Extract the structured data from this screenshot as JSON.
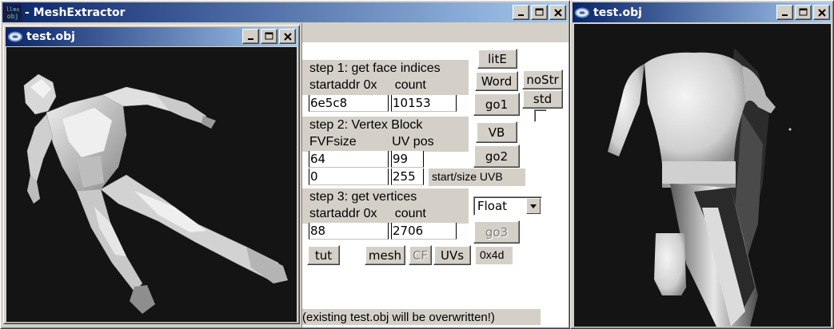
{
  "main_window": {
    "title": "- MeshExtractor",
    "icon_text_top": "ll⊗x",
    "icon_text_bottom": "obj"
  },
  "left_viewer": {
    "title": "test.obj"
  },
  "right_viewer": {
    "title": "test.obj"
  },
  "panel": {
    "step1_label": "step 1: get face indices",
    "step1_sub": "startaddr 0x     count",
    "face_startaddr": "6e5c8",
    "face_count": "10153",
    "step2_label": "step 2: Vertex Block",
    "step2_sub": "FVFsize          UV pos",
    "fvf_size": "64",
    "uv_pos": "99",
    "uvb_start": "0",
    "uvb_size": "255",
    "uvb_label": "start/size UVB",
    "step3_label": "step 3: get vertices",
    "step3_sub": "startaddr 0x     count",
    "vert_startaddr": "88",
    "vert_count": "2706",
    "format_selected": "Float",
    "hex_readout": "0x4d",
    "warning": "(existing test.obj will be overwritten!)"
  },
  "buttons": {
    "lite": "litE",
    "word": "Word",
    "nostr": "noStr",
    "std": "std",
    "go1": "go1",
    "vb": "VB",
    "go2": "go2",
    "go3": "go3",
    "tut": "tut",
    "mesh": "mesh",
    "cf": "CF",
    "uvs": "UVs"
  },
  "colors": {
    "title_active": "#0a246a",
    "title_inactive": "#808080",
    "face_bg": "#d4d0c8",
    "viewport_bg": "#141414"
  }
}
